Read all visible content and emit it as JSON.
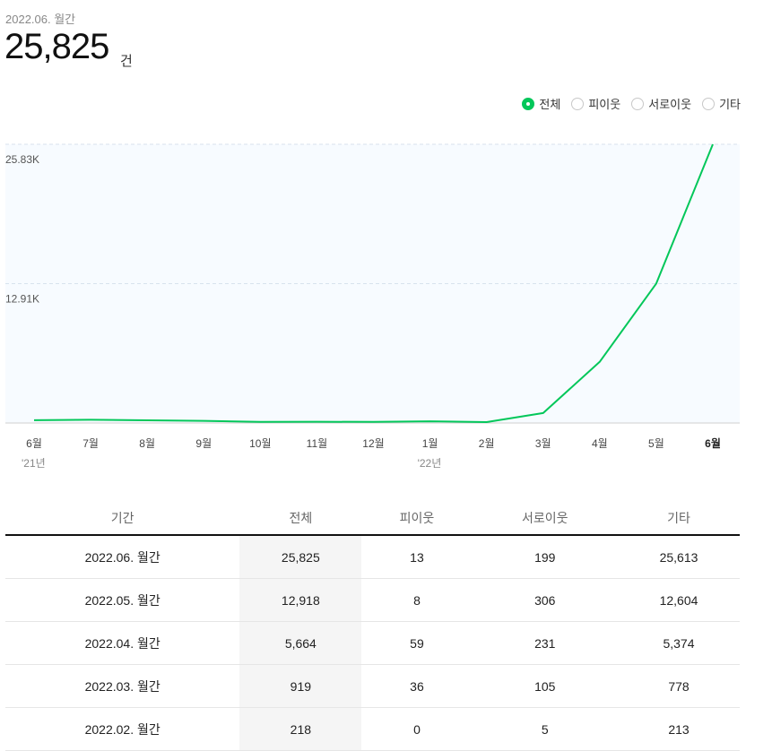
{
  "header": {
    "period": "2022.06. 월간",
    "total": "25,825",
    "unit": "건"
  },
  "filters": [
    {
      "label": "전체",
      "selected": true
    },
    {
      "label": "피이웃",
      "selected": false
    },
    {
      "label": "서로이웃",
      "selected": false
    },
    {
      "label": "기타",
      "selected": false
    }
  ],
  "chart_data": {
    "type": "line",
    "categories": [
      "6월",
      "7월",
      "8월",
      "9월",
      "10월",
      "11월",
      "12월",
      "1월",
      "2월",
      "3월",
      "4월",
      "5월",
      "6월"
    ],
    "year_labels": [
      {
        "index": 0,
        "label": "'21년"
      },
      {
        "index": 7,
        "label": "'22년"
      }
    ],
    "series": [
      {
        "values": [
          260,
          300,
          250,
          200,
          100,
          120,
          100,
          160,
          80,
          919,
          5664,
          12918,
          25825
        ]
      }
    ],
    "y_ticks": [
      "12.91K",
      "25.83K"
    ],
    "y_tick_values": [
      12912.5,
      25825
    ],
    "ylim": [
      0,
      25825
    ],
    "line_color": "#03c75a",
    "grid": true
  },
  "table": {
    "headers": [
      "기간",
      "전체",
      "피이웃",
      "서로이웃",
      "기타"
    ],
    "rows": [
      [
        "2022.06. 월간",
        "25,825",
        "13",
        "199",
        "25,613"
      ],
      [
        "2022.05. 월간",
        "12,918",
        "8",
        "306",
        "12,604"
      ],
      [
        "2022.04. 월간",
        "5,664",
        "59",
        "231",
        "5,374"
      ],
      [
        "2022.03. 월간",
        "919",
        "36",
        "105",
        "778"
      ],
      [
        "2022.02. 월간",
        "218",
        "0",
        "5",
        "213"
      ]
    ]
  }
}
